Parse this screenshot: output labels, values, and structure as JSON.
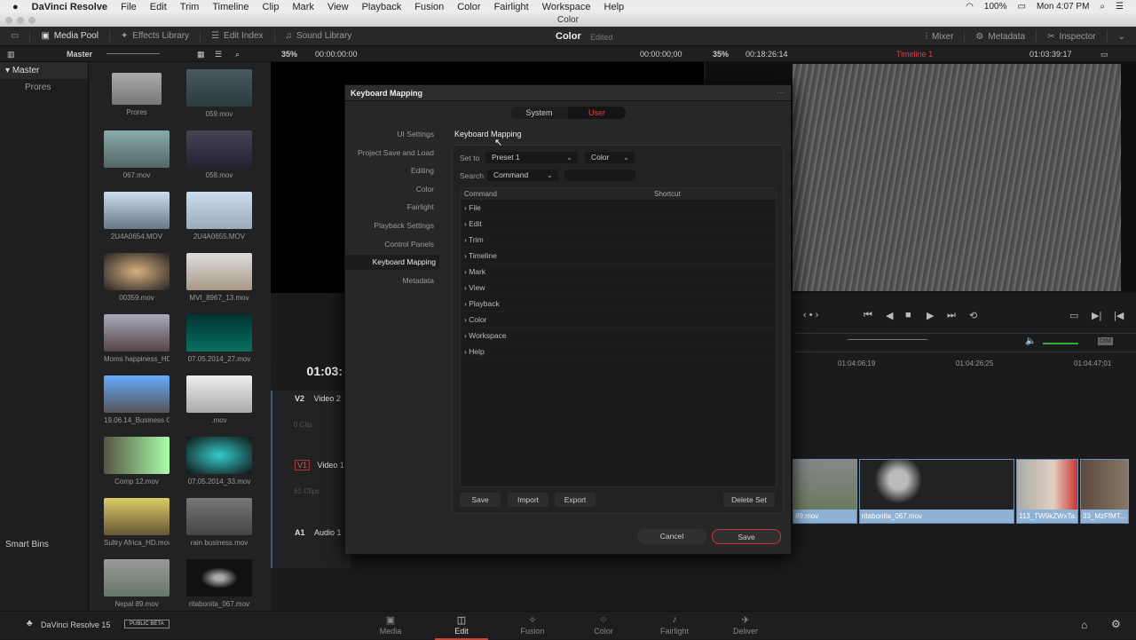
{
  "menubar": {
    "app": "DaVinci Resolve",
    "items": [
      "File",
      "Edit",
      "Trim",
      "Timeline",
      "Clip",
      "Mark",
      "View",
      "Playback",
      "Fusion",
      "Color",
      "Fairlight",
      "Workspace",
      "Help"
    ],
    "battery": "100%",
    "clock": "Mon 4:07 PM"
  },
  "window_title": "Color",
  "toolbar": {
    "media_pool": "Media Pool",
    "effects": "Effects Library",
    "edit_index": "Edit Index",
    "sound": "Sound Library",
    "project": "Color",
    "status": "Edited",
    "mixer": "Mixer",
    "metadata": "Metadata",
    "inspector": "Inspector"
  },
  "subbar": {
    "bin": "Master",
    "zoom1": "35%",
    "tc1": "00:00:00:00",
    "tc2": "00:00:00;00",
    "zoom2": "35%",
    "tc3": "00:18:26:14",
    "timeline": "Timeline 1",
    "tc4": "01:03:39:17"
  },
  "sidebar": {
    "master": "Master",
    "prores": "Prores",
    "smart_bins": "Smart Bins"
  },
  "clips": [
    "Prores",
    "059.mov",
    "067.mov",
    "058.mov",
    "2U4A0654.MOV",
    "2U4A0655.MOV",
    "00359.mov",
    "MVI_8967_13.mov",
    "Moms happiness_HD...",
    "07.05.2014_27.mov",
    "19.06.14_Business G...",
    ".mov",
    "Comp 12.mov",
    "07.05.2014_33.mov",
    "Sultry Africa_HD.mov",
    "rain business.mov",
    "Nepal 89.mov",
    "ritabonita_067.mov"
  ],
  "timeline": {
    "timecode": "01:03:",
    "ruler": [
      "01:04:06;19",
      "01:04:26;25",
      "01:04:47;01"
    ],
    "tracks": [
      {
        "id": "V2",
        "name": "Video 2",
        "count": "0 Clip"
      },
      {
        "id": "V1",
        "name": "Video 1",
        "count": "61 Clips"
      },
      {
        "id": "A1",
        "name": "Audio 1"
      }
    ],
    "clips": [
      "89.mov",
      "ritabonita_067.mov",
      "113_TW9kZWxTa...",
      "33_MzFfMT..."
    ]
  },
  "dialog": {
    "title": "Keyboard Mapping",
    "seg": [
      "System",
      "User"
    ],
    "nav": [
      "UI Settings",
      "Project Save and Load",
      "Editing",
      "Color",
      "Fairlight",
      "Playback Settings",
      "Control Panels",
      "Keyboard Mapping",
      "Metadata"
    ],
    "heading": "Keyboard Mapping",
    "set_to_label": "Set to",
    "preset": "Preset 1",
    "page": "Color",
    "search_label": "Search",
    "search_by": "Command",
    "search_value": "",
    "col_command": "Command",
    "col_shortcut": "Shortcut",
    "rows": [
      "File",
      "Edit",
      "Trim",
      "Timeline",
      "Mark",
      "View",
      "Playback",
      "Color",
      "Workspace",
      "Help"
    ],
    "save_set": "Save",
    "import": "Import",
    "export": "Export",
    "delete_set": "Delete Set",
    "cancel": "Cancel",
    "save": "Save"
  },
  "bottom": {
    "app": "DaVinci Resolve 15",
    "badge": "PUBLIC BETA",
    "pages": [
      "Media",
      "Edit",
      "Fusion",
      "Color",
      "Fairlight",
      "Deliver"
    ]
  }
}
